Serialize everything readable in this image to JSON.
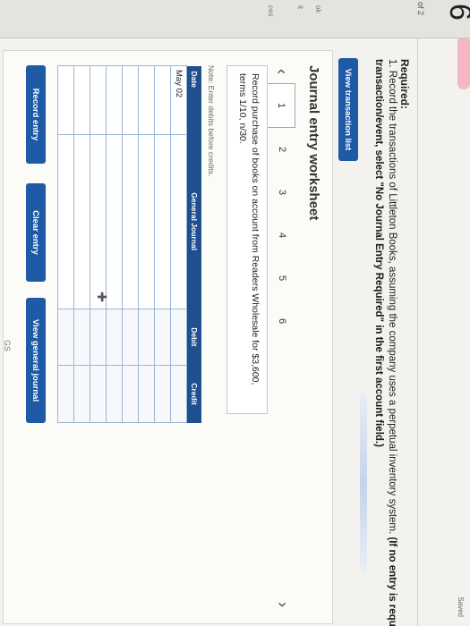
{
  "header": {
    "question_number": "6",
    "page_indicator": "of 2",
    "saved": "Saved"
  },
  "side_labels": [
    "ok",
    "it",
    "ces"
  ],
  "prompt": {
    "required_label": "Required:",
    "instruction_line1": "1. Record the transactions of Littleton Books, assuming the company uses a perpetual inventory system.",
    "instruction_paren": "(If no entry is requi",
    "instruction_line2": "transaction/event, select \"No Journal Entry Required\" in the first account field.)"
  },
  "buttons": {
    "view_transaction_list": "View transaction list",
    "record_entry": "Record entry",
    "clear_entry": "Clear entry",
    "view_general_journal": "View general journal"
  },
  "worksheet": {
    "title": "Journal entry worksheet",
    "tabs": [
      "1",
      "2",
      "3",
      "4",
      "5",
      "6"
    ],
    "active_tab": "1",
    "description": "Record purchase of books on account from Readers Wholesale for $3,600, terms 1/10, n/30.",
    "note": "Note: Enter debits before credits.",
    "columns": [
      "Date",
      "General Journal",
      "Debit",
      "Credit"
    ],
    "rows": [
      {
        "date": "May 02",
        "account": "",
        "debit": "",
        "credit": ""
      },
      {
        "date": "",
        "account": "",
        "debit": "",
        "credit": ""
      },
      {
        "date": "",
        "account": "",
        "debit": "",
        "credit": ""
      },
      {
        "date": "",
        "account": "",
        "debit": "",
        "credit": ""
      },
      {
        "date": "",
        "account": "",
        "debit": "",
        "credit": ""
      },
      {
        "date": "",
        "account": "",
        "debit": "",
        "credit": ""
      },
      {
        "date": "",
        "account": "",
        "debit": "",
        "credit": ""
      },
      {
        "date": "",
        "account": "",
        "debit": "",
        "credit": ""
      }
    ]
  },
  "footer": {
    "page_mark": "GS"
  },
  "icons": {
    "prev": "chevron-left-icon",
    "next": "chevron-right-icon",
    "cursor": "crosshair-plus-icon"
  },
  "colors": {
    "button": "#1f5aa6",
    "table_header": "#1f4f8f"
  }
}
